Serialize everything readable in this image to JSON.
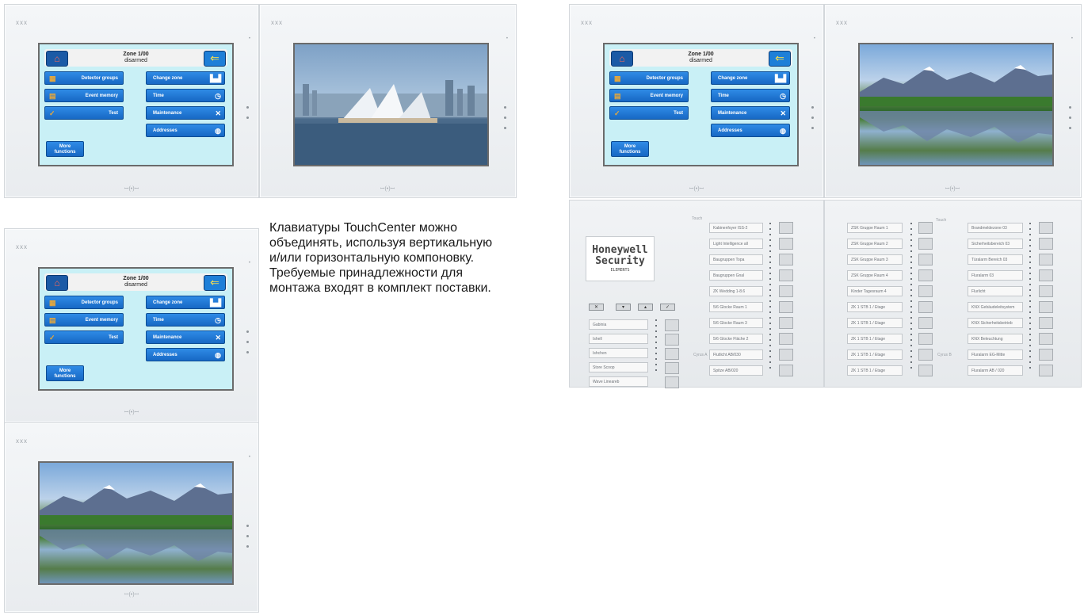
{
  "brand_logo": "xxx",
  "device_bottom_mark": "ꟷ(•)ꟷ",
  "menu": {
    "zone_title": "Zone 1/00",
    "zone_status": "disarmed",
    "home_icon": "home-icon",
    "back_icon": "back-arrow-icon",
    "left_buttons": [
      {
        "label": "Detector groups",
        "icon": "detector-groups-icon"
      },
      {
        "label": "Event memory",
        "icon": "event-memory-icon"
      },
      {
        "label": "Test",
        "icon": "test-check-icon"
      }
    ],
    "right_buttons": [
      {
        "label": "Change zone",
        "icon": "change-zone-icon"
      },
      {
        "label": "Time",
        "icon": "clock-icon"
      },
      {
        "label": "Maintenance",
        "icon": "tools-icon"
      },
      {
        "label": "Addresses",
        "icon": "globe-icon"
      }
    ],
    "more_line1": "More",
    "more_line2": "functions"
  },
  "caption": {
    "line1": "Клавиатуры TouchCenter можно",
    "line2": "объединять, используя вертикальную",
    "line3": "и/или горизонтальную компоновку.",
    "line4": "Требуемые принадлежности для",
    "line5": "монтажа входят в комплект поставки."
  },
  "panel_a": {
    "brand_line1": "Honeywell",
    "brand_line2": "Security",
    "brand_line3": "ELEMENTS",
    "controls": [
      "✕",
      "▾",
      "▴",
      "✓"
    ],
    "left_list": [
      "Gabinia",
      "Ishell",
      "Ishchen",
      "Store Scoop",
      "Wave Lineareb"
    ],
    "right_list": [
      "Kabinenfoyer ISS-2",
      "Light Intelligence all",
      "Baugruppen Topa",
      "Baugruppen Gnal",
      "ZK Wedding 1-8.6",
      "5/6 Glocke Raum 1",
      "5/6 Glocke Raum 3",
      "5/6 Glocke Fläche 2",
      "Flutlicht AB/030",
      "Spitze AB/020"
    ],
    "mini_top": "Touch",
    "mini_side": "Cyrus A"
  },
  "panel_b": {
    "left_list": [
      "ZSK Gruppe Raum 1",
      "ZSK Gruppe Raum 2",
      "ZSK Gruppe Raum 3",
      "ZSK Gruppe Raum 4",
      "Kinder Tagesraum 4",
      "ZK 1 STB 1 / Etage",
      "ZK 1 STB 1 / Etage",
      "ZK 1 STB 1 / Etage",
      "ZK 1 STB 1 / Etage",
      "ZK 1 STB 1 / Etage"
    ],
    "right_list": [
      "Brandmeldezone 03",
      "Sicherheitsbereich 03",
      "Türalarm Bereich 03",
      "Fluralarm 03",
      "Flurlicht",
      "KNX Gebäudeleitsystem",
      "KNX Sicherheitsbetrieb",
      "KNX Beleuchtung",
      "Fluralarm EG-Mitte",
      "Fluralarm AB / 020"
    ],
    "mini_top": "Touch",
    "mini_side": "Cyrus B"
  }
}
